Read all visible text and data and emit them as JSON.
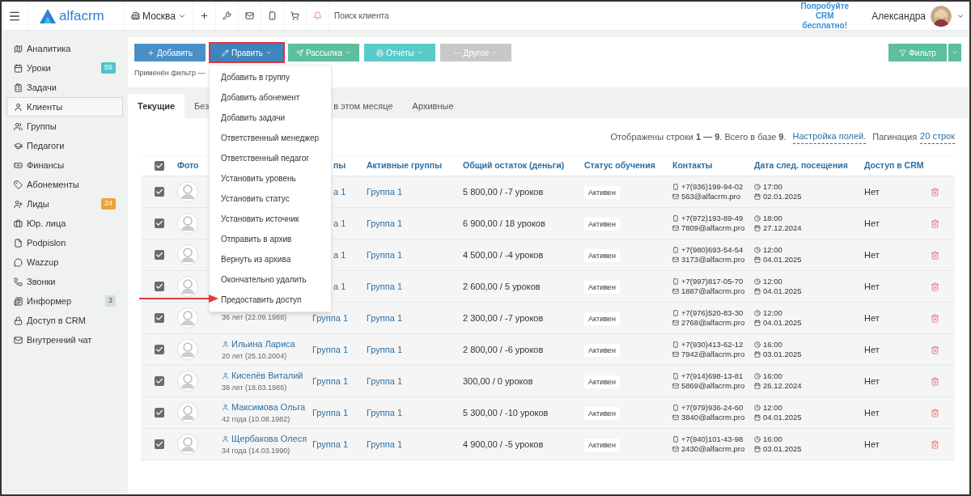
{
  "topbar": {
    "logo": "alfacrm",
    "city": "Москва",
    "search": {
      "placeholder": "Поиск клиента"
    },
    "promo": "Попробуйте CRM бесплатно!",
    "user": "Александра"
  },
  "sidebar": {
    "items": [
      {
        "label": "Аналитика",
        "selected": false
      },
      {
        "label": "Уроки",
        "selected": false,
        "badge": "59",
        "color": "#4fc3c9"
      },
      {
        "label": "Задачи",
        "selected": false
      },
      {
        "label": "Клиенты",
        "selected": true
      },
      {
        "label": "Группы",
        "selected": false
      },
      {
        "label": "Педагоги",
        "selected": false
      },
      {
        "label": "Финансы",
        "selected": false
      },
      {
        "label": "Абонементы",
        "selected": false
      },
      {
        "label": "Лиды",
        "selected": false,
        "badge": "24",
        "color": "#f0a13c"
      },
      {
        "label": "Юр. лица",
        "selected": false
      },
      {
        "label": "Podpislon",
        "selected": false
      },
      {
        "label": "Wazzup",
        "selected": false
      },
      {
        "label": "Звонки",
        "selected": false
      },
      {
        "label": "Информер",
        "selected": false,
        "badge": "3",
        "color": "#d5dede"
      },
      {
        "label": "Доступ в CRM",
        "selected": false
      },
      {
        "label": "Внутренний чат",
        "selected": false
      }
    ]
  },
  "toolbar": {
    "buttons": [
      {
        "label": "Добавить",
        "color": "#4a90c8",
        "highlighted": false,
        "caret": false
      },
      {
        "label": "Править",
        "color": "#3f84bd",
        "highlighted": true,
        "caret": true
      },
      {
        "label": "Рассылка",
        "color": "#5cbf9e",
        "highlighted": false,
        "caret": true
      },
      {
        "label": "Отчеты",
        "color": "#5bcbc9",
        "highlighted": false,
        "caret": true
      },
      {
        "label": "Другое",
        "color": "#c8c8c8",
        "highlighted": false,
        "caret": true
      }
    ],
    "filter_button": "Фильтр",
    "filter_text": "Применён фильтр —"
  },
  "edit_menu": {
    "items": [
      "Добавить в группу",
      "Добавить абонемент",
      "Добавить задачи",
      "Ответственный менеджер",
      "Ответственный педагог",
      "Установить уровень",
      "Установить статус",
      "Установить источник",
      "Отправить в архив",
      "Вернуть из архива",
      "Окончательно удалить",
      "Предоставить доступ"
    ]
  },
  "tabs": [
    {
      "label": "Текущие",
      "selected": true
    },
    {
      "label": "Без",
      "selected": false
    },
    {
      "label": "в этом месяце",
      "selected": false
    },
    {
      "label": "Архивные",
      "selected": false
    }
  ],
  "table_info": {
    "text": "Отображены строки **1 — 9**. Всего в базе **9**.",
    "fields_link": "Настройка полей.",
    "pagination_label": "Пагинация",
    "pagination_link": "20 строк"
  },
  "table": {
    "all_checked": true,
    "columns": [
      "Фото",
      "пы",
      "Активные группы",
      "Общий остаток (деньги)",
      "Статус обучения",
      "Контакты",
      "Дата след. посещения",
      "Доступ в CRM"
    ],
    "rows": [
      {
        "checked": true,
        "groups": "а 1",
        "active_group": "Группа 1",
        "balance": "5 800,00 / -7 уроков",
        "status": "Активен",
        "phone": "+7(936)199-94-02",
        "email": "563@alfacrm.pro",
        "time": "17:00",
        "date": "02.01.2025",
        "access": "Нет"
      },
      {
        "checked": true,
        "groups": "а 1",
        "active_group": "Группа 1",
        "balance": "6 900,00 / 18 уроков",
        "status": "Активен",
        "phone": "+7(972)193-89-49",
        "email": "7809@alfacrm.pro",
        "time": "18:00",
        "date": "27.12.2024",
        "access": "Нет"
      },
      {
        "checked": true,
        "groups": "а 1",
        "active_group": "Группа 1",
        "balance": "4 500,00 / -4 уроков",
        "status": "Активен",
        "phone": "+7(980)693-54-54",
        "email": "3173@alfacrm.pro",
        "time": "12:00",
        "date": "04.01.2025",
        "access": "Нет"
      },
      {
        "checked": true,
        "groups": "а 1",
        "active_group": "Группа 1",
        "balance": "2 600,00 / 5 уроков",
        "status": "Активен",
        "phone": "+7(997)817-05-70",
        "email": "1887@alfacrm.pro",
        "time": "12:00",
        "date": "04.01.2025",
        "access": "Нет"
      },
      {
        "checked": true,
        "age": "36 лет (22.09.1988)",
        "groups": "Группа 1",
        "active_group": "Группа 1",
        "balance": "2 300,00 / -7 уроков",
        "status": "Активен",
        "phone": "+7(976)520-83-30",
        "email": "2768@alfacrm.pro",
        "time": "12:00",
        "date": "04.01.2025",
        "access": "Нет"
      },
      {
        "checked": true,
        "name": "Ильина Лариса",
        "age": "20 лет (25.10.2004)",
        "groups": "Группа 1",
        "active_group": "Группа 1",
        "balance": "2 800,00 / -6 уроков",
        "status": "Активен",
        "phone": "+7(930)413-62-12",
        "email": "7942@alfacrm.pro",
        "time": "16:00",
        "date": "03.01.2025",
        "access": "Нет"
      },
      {
        "checked": true,
        "name": "Киселёв Виталий",
        "age": "38 лет (18.03.1986)",
        "groups": "Группа 1",
        "active_group": "Группа 1",
        "balance": "300,00 / 0 уроков",
        "status": "Активен",
        "phone": "+7(914)698-13-81",
        "email": "5869@alfacrm.pro",
        "time": "16:00",
        "date": "26.12.2024",
        "access": "Нет"
      },
      {
        "checked": true,
        "name": "Максимова Ольга",
        "age": "42 года (10.08.1982)",
        "groups": "Группа 1",
        "active_group": "Группа 1",
        "balance": "5 300,00 / -10 уроков",
        "status": "Активен",
        "phone": "+7(979)936-24-60",
        "email": "3840@alfacrm.pro",
        "time": "12:00",
        "date": "04.01.2025",
        "access": "Нет"
      },
      {
        "checked": true,
        "name": "Щербакова Олеся",
        "age": "34 года (14.03.1990)",
        "groups": "Группа 1",
        "active_group": "Группа 1",
        "balance": "4 900,00 / -5 уроков",
        "status": "Активен",
        "phone": "+7(940)101-43-98",
        "email": "2430@alfacrm.pro",
        "time": "16:00",
        "date": "03.01.2025",
        "access": "Нет"
      }
    ]
  }
}
